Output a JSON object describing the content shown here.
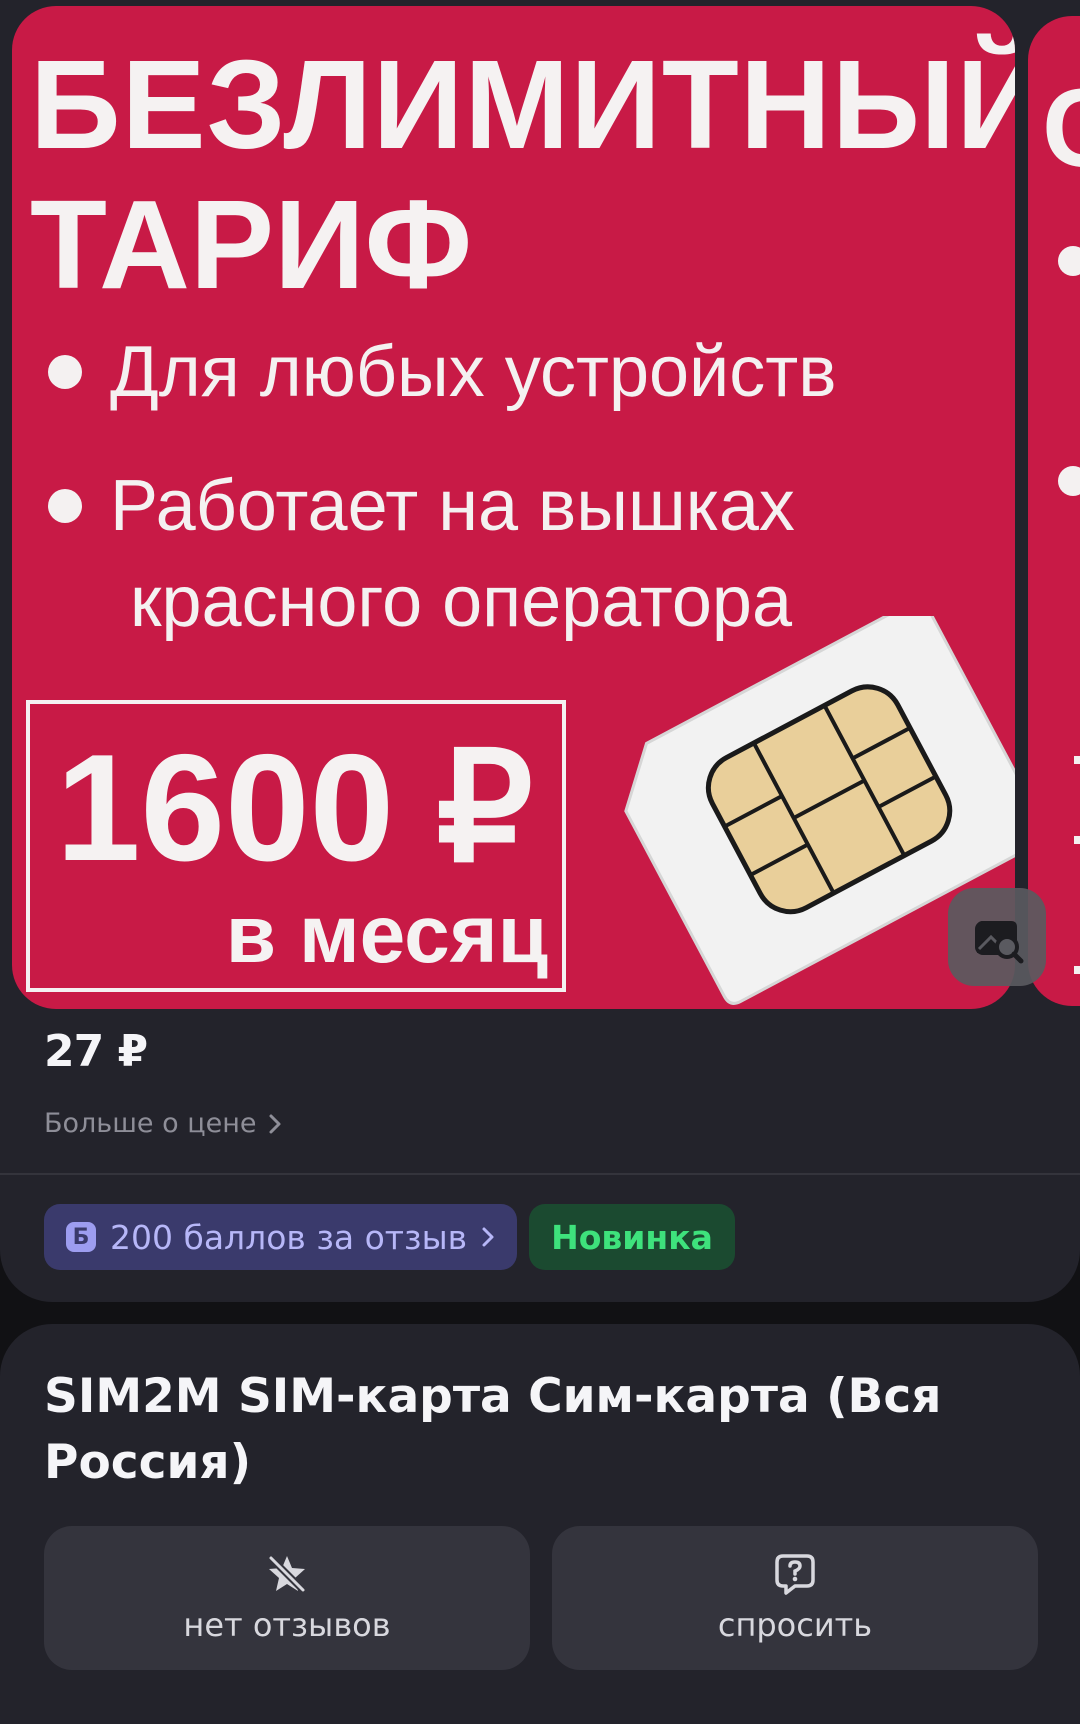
{
  "banner": {
    "headline_line1": "БЕЗЛИМИТНЫЙ",
    "headline_line2": "ТАРИФ",
    "bullet1": "Для любых устройств",
    "bullet2_line1": "Работает на вышках",
    "bullet2_line2": "красного оператора",
    "price": "1600 ₽",
    "price_period": "в месяц",
    "next_slide_letter": "С",
    "accent_color": "#c81a46"
  },
  "product": {
    "price": "27 ₽",
    "price_more_label": "Больше о цене",
    "points_badge_icon": "Б",
    "points_badge_label": "200 баллов за отзыв",
    "new_badge_label": "Новинка",
    "title": "SIM2M SIM-карта Сим-карта (Вся Россия)"
  },
  "actions": {
    "reviews_label": "нет отзывов",
    "reviews_icon": "star-crossed-icon",
    "ask_label": "спросить",
    "ask_icon": "question-bubble-icon"
  },
  "icons": {
    "image_search": "image-search-icon",
    "chevron": "chevron-right-icon"
  }
}
